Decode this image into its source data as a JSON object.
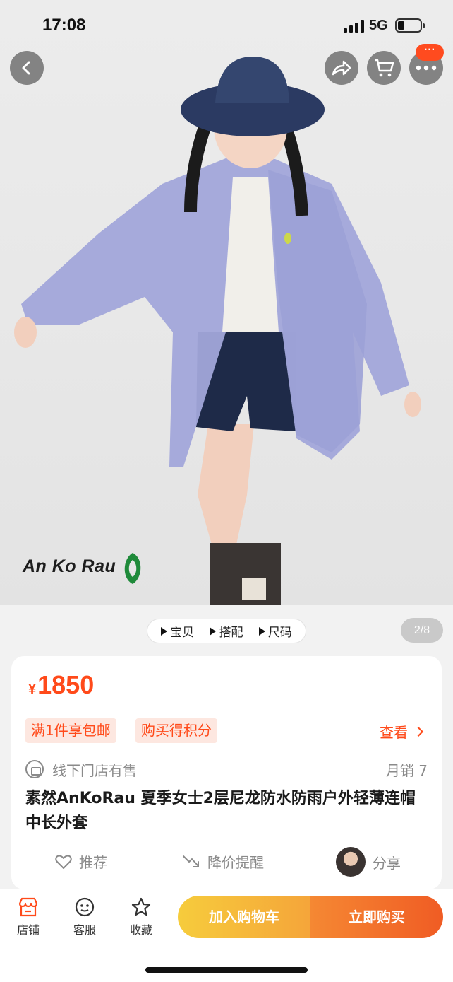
{
  "status": {
    "time": "17:08",
    "network": "5G"
  },
  "hero": {
    "brand_text": "An Ko Rau"
  },
  "top_actions": {
    "more_badge": "···"
  },
  "media_tabs": [
    {
      "label": "宝贝"
    },
    {
      "label": "搭配"
    },
    {
      "label": "尺码"
    }
  ],
  "page_indicator": "2/8",
  "product": {
    "currency": "¥",
    "price": "1850",
    "tags": [
      "满1件享包邮",
      "购买得积分"
    ],
    "view_label": "查看",
    "store_note": "线下门店有售",
    "monthly_sales": "月销 7",
    "title": "素然AnKoRau 夏季女士2层尼龙防水防雨户外轻薄连帽中长外套"
  },
  "actions": {
    "recommend": "推荐",
    "price_alert": "降价提醒",
    "share": "分享"
  },
  "bottom_nav": [
    {
      "label": "店铺"
    },
    {
      "label": "客服"
    },
    {
      "label": "收藏"
    }
  ],
  "buttons": {
    "add_to_cart": "加入购物车",
    "buy_now": "立即购买"
  },
  "colors": {
    "accent": "#ff4a1a",
    "cart_gradient": "#f6cc3c",
    "buy_gradient": "#f05c24",
    "jacket": "#9ea4d8"
  }
}
